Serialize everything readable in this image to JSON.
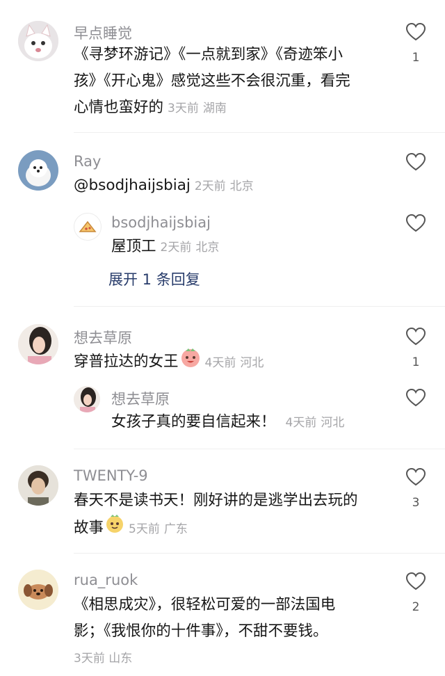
{
  "comments": [
    {
      "username": "早点睡觉",
      "text": "《寻梦环游记》《一点就到家》《奇迹笨小孩》《开心鬼》感觉这些不会很沉重，看完心情也蛮好的",
      "line1": "《寻梦环游记》《一点就到家》《奇迹笨小",
      "line2": "孩》《开心鬼》感觉这些不会很沉重，看完",
      "line3": "心情也蛮好的",
      "time": "3天前",
      "location": "湖南",
      "likes": "1",
      "avatar_icon": "white-cat-avatar-icon"
    },
    {
      "username": "Ray",
      "text": "@bsodjhaijsbiaj",
      "time": "2天前",
      "location": "北京",
      "likes": "",
      "avatar_icon": "white-dog-avatar-icon",
      "reply": {
        "username": "bsodjhaijsbiaj",
        "text": "屋顶工",
        "time": "2天前",
        "location": "北京",
        "likes": "",
        "avatar_icon": "pizza-avatar-icon"
      },
      "expand_label": "展开 1 条回复"
    },
    {
      "username": "想去草原",
      "text": "穿普拉达的女王",
      "emoji": "smile-face-emoji-icon",
      "time": "4天前",
      "location": "河北",
      "likes": "1",
      "avatar_icon": "girl-photo-avatar-icon",
      "reply": {
        "username": "想去草原",
        "text": "女孩子真的要自信起来！",
        "time": "4天前",
        "location": "河北",
        "likes": "",
        "avatar_icon": "girl-photo-avatar-icon"
      }
    },
    {
      "username": "TWENTY-9",
      "line1": "春天不是读书天！刚好讲的是逃学出去玩的",
      "line2": "故事",
      "emoji": "cheeky-face-emoji-icon",
      "time": "5天前",
      "location": "广东",
      "likes": "3",
      "avatar_icon": "man-photo-avatar-icon"
    },
    {
      "username": "rua_ruok",
      "line1": "《相思成灾》，很轻松可爱的一部法国电",
      "line2": "影；《我恨你的十件事》，不甜不要钱。",
      "time": "3天前",
      "location": "山东",
      "likes": "2",
      "avatar_icon": "puppy-cartoon-avatar-icon"
    }
  ],
  "colors": {
    "text": "#161616",
    "username": "#8e8e93",
    "meta": "#a5a5a8",
    "expand": "#283c6b",
    "heart_outline": "#555555"
  }
}
